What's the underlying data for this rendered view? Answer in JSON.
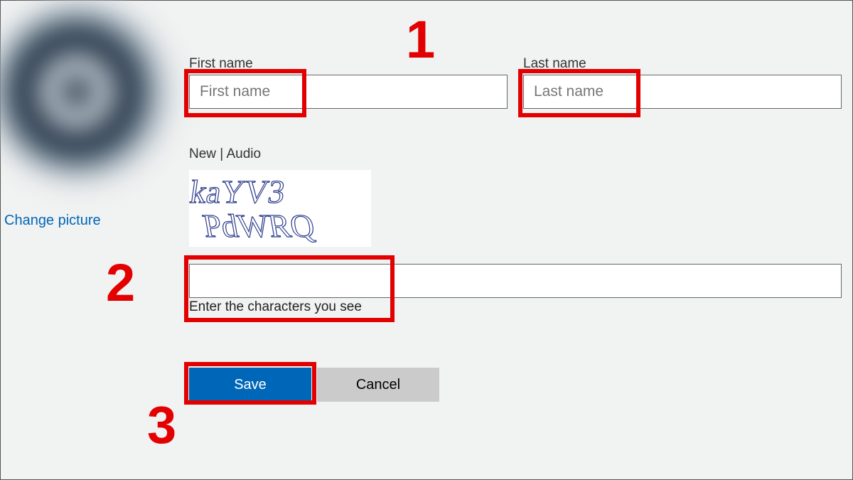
{
  "avatar": {
    "change_label": "Change picture"
  },
  "form": {
    "first_name": {
      "label": "First name",
      "placeholder": "First name"
    },
    "last_name": {
      "label": "Last name",
      "placeholder": "Last name"
    }
  },
  "captcha": {
    "links_text": "New | Audio",
    "image_text_line1": "kaYV3",
    "image_text_line2": "PdWRQ",
    "help": "Enter the characters you see"
  },
  "buttons": {
    "save": "Save",
    "cancel": "Cancel"
  },
  "annotations": {
    "step1": "1",
    "step2": "2",
    "step3": "3"
  }
}
